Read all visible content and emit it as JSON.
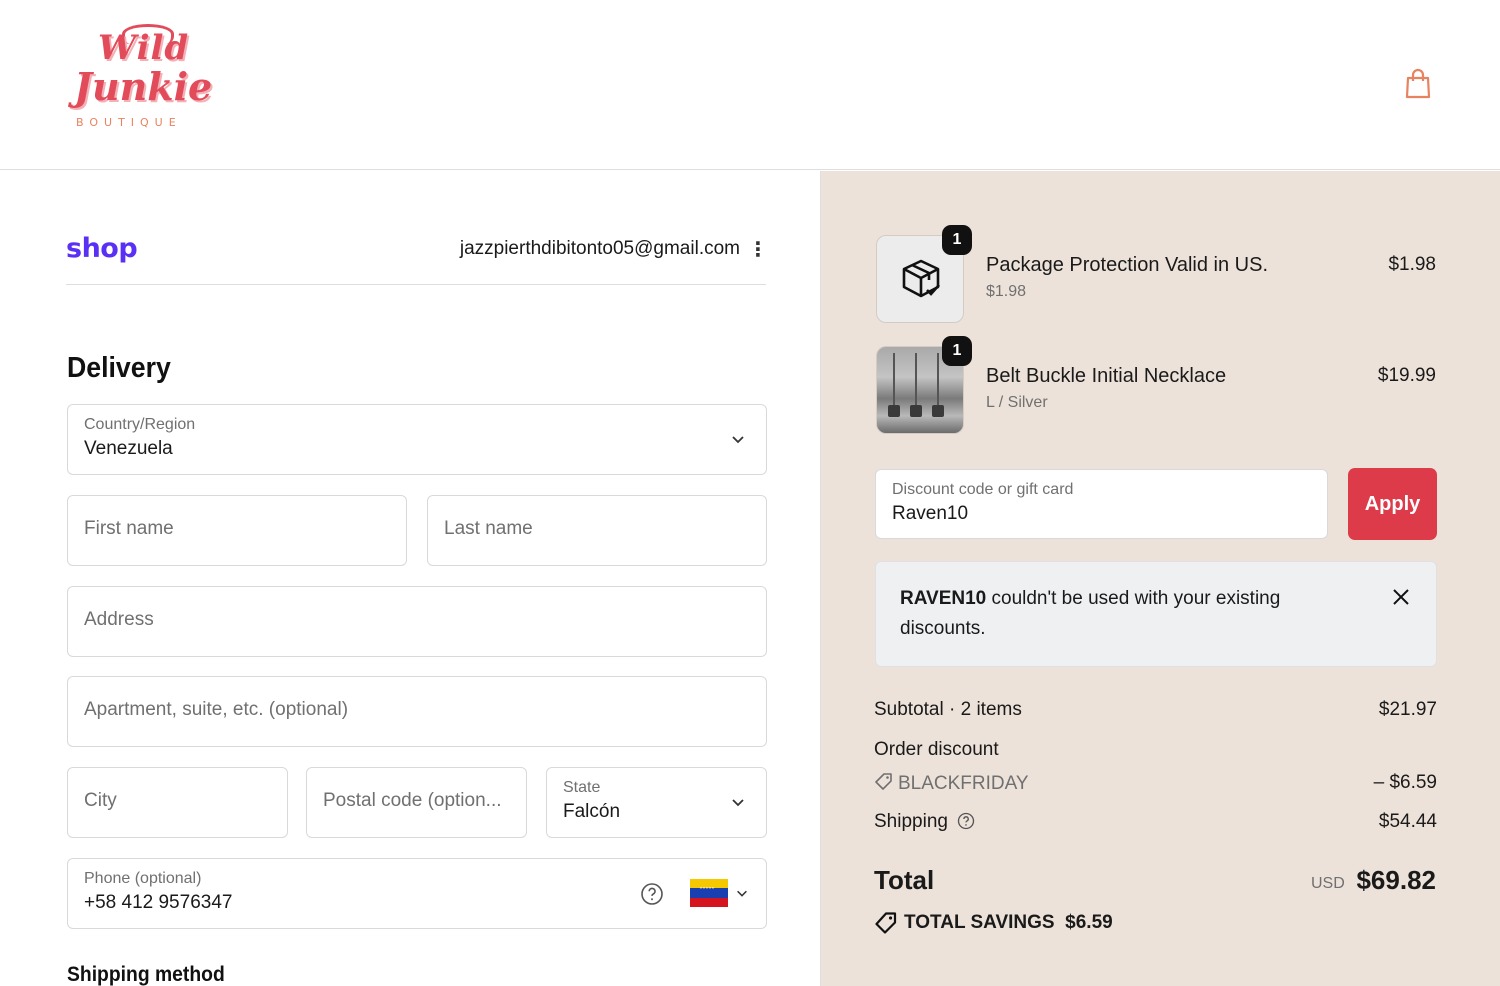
{
  "brand": {
    "line1": "Wild",
    "line2": "Junkie",
    "line3": "BOUTIQUE"
  },
  "header": {
    "cart_icon": "shopping-bag-icon"
  },
  "account": {
    "shop_logo": "shop",
    "email": "jazzpierthdibitonto05@gmail.com",
    "menu_icon": "kebab-menu-icon"
  },
  "delivery": {
    "title": "Delivery",
    "country": {
      "label": "Country/Region",
      "value": "Venezuela"
    },
    "first_name": {
      "placeholder": "First name"
    },
    "last_name": {
      "placeholder": "Last name"
    },
    "address": {
      "placeholder": "Address"
    },
    "apartment": {
      "placeholder": "Apartment, suite, etc. (optional)"
    },
    "city": {
      "placeholder": "City"
    },
    "postal": {
      "placeholder": "Postal code (option..."
    },
    "state": {
      "label": "State",
      "value": "Falcón"
    },
    "phone": {
      "label": "Phone (optional)",
      "value": "+58 412 9576347",
      "flag": "venezuela-flag"
    }
  },
  "shipping_method": {
    "title": "Shipping method"
  },
  "summary": {
    "items": [
      {
        "title": "Package Protection Valid in US.",
        "sub": "$1.98",
        "price": "$1.98",
        "qty": "1",
        "icon": "package-check-icon"
      },
      {
        "title": "Belt Buckle Initial Necklace",
        "sub": "L / Silver",
        "price": "$19.99",
        "qty": "1"
      }
    ],
    "discount": {
      "label": "Discount code or gift card",
      "value": "Raven10",
      "apply": "Apply"
    },
    "notice": {
      "code": "RAVEN10",
      "message": " couldn't be used with your existing discounts."
    },
    "subtotal": {
      "label": "Subtotal · 2 items",
      "value": "$21.97"
    },
    "order_discount": {
      "label": "Order discount",
      "code": "BLACKFRIDAY",
      "value": "– $6.59"
    },
    "shipping": {
      "label": "Shipping",
      "value": "$54.44"
    },
    "total": {
      "label": "Total",
      "currency": "USD",
      "value": "$69.82"
    },
    "savings": {
      "label": "TOTAL SAVINGS",
      "value": "$6.59"
    }
  },
  "colors": {
    "accent": "#dd3a4a",
    "shop_purple": "#5a31f4",
    "summary_bg": "#ede2da"
  }
}
